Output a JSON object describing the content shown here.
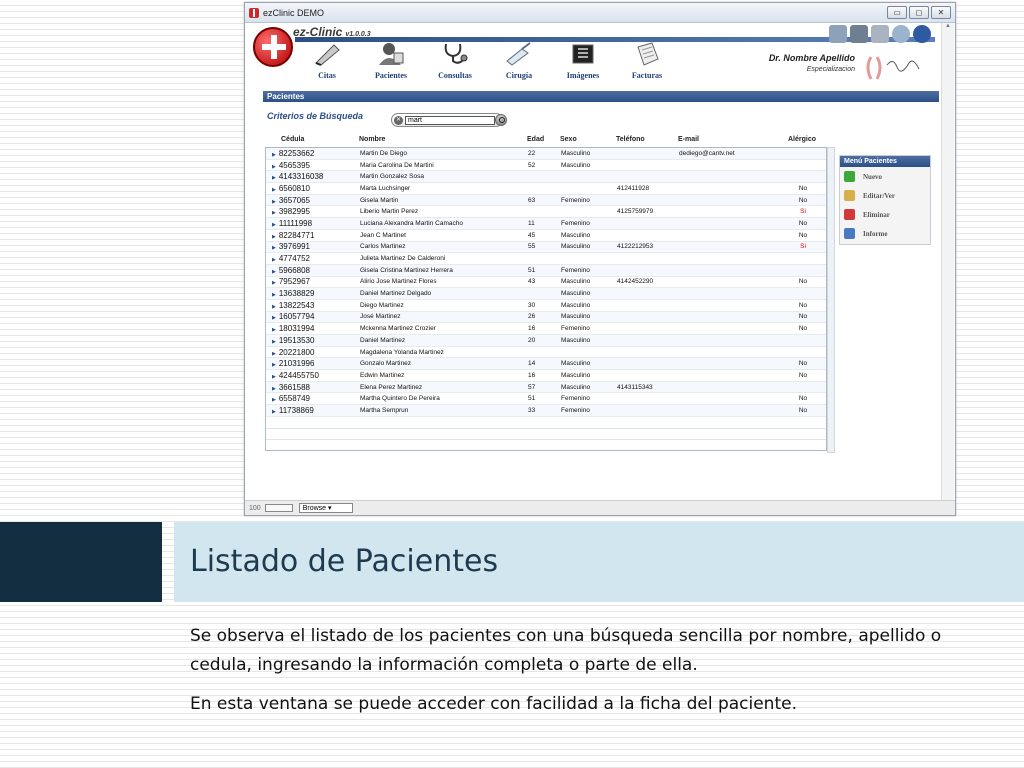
{
  "window": {
    "title": "ezClinic DEMO",
    "buttons": [
      "▭",
      "◻",
      "✕"
    ]
  },
  "app": {
    "name": "ez-Clinic",
    "version": "v1.0.0.3"
  },
  "nav": [
    {
      "label": "Citas",
      "icon": "pen-icon"
    },
    {
      "label": "Pacientes",
      "icon": "patient-icon"
    },
    {
      "label": "Consultas",
      "icon": "stethoscope-icon"
    },
    {
      "label": "Cirugía",
      "icon": "scalpel-icon"
    },
    {
      "label": "Imágenes",
      "icon": "xray-icon"
    },
    {
      "label": "Facturas",
      "icon": "invoice-icon"
    }
  ],
  "doctor": {
    "name": "Dr. Nombre Apellido",
    "specialty": "Especializacion"
  },
  "section": {
    "title": "Pacientes",
    "search_title": "Criterios de Búsqueda",
    "search_value": "mart"
  },
  "table": {
    "headers": {
      "cedula": "Cédula",
      "nombre": "Nombre",
      "edad": "Edad",
      "sexo": "Sexo",
      "telefono": "Teléfono",
      "email": "E-mail",
      "alergico": "Alérgico"
    },
    "rows": [
      {
        "cedula": "82253662",
        "nombre": "Martin De Diego",
        "edad": "22",
        "sexo": "Masculino",
        "telefono": "",
        "email": "dediego@cantv.net",
        "alergico": ""
      },
      {
        "cedula": "4565395",
        "nombre": "Maria Carolina De Martini",
        "edad": "52",
        "sexo": "Masculino",
        "telefono": "",
        "email": "",
        "alergico": ""
      },
      {
        "cedula": "4143316038",
        "nombre": "Martin Gonzalez Sosa",
        "edad": "",
        "sexo": "",
        "telefono": "",
        "email": "",
        "alergico": ""
      },
      {
        "cedula": "6560810",
        "nombre": "Marta Luchsinger",
        "edad": "",
        "sexo": "",
        "telefono": "412411928",
        "email": "",
        "alergico": "No"
      },
      {
        "cedula": "3657065",
        "nombre": "Gisela Martin",
        "edad": "63",
        "sexo": "Femenino",
        "telefono": "",
        "email": "",
        "alergico": "No"
      },
      {
        "cedula": "3982995",
        "nombre": "Liberio Martin Perez",
        "edad": "",
        "sexo": "",
        "telefono": "4125759979",
        "email": "",
        "alergico": "Si"
      },
      {
        "cedula": "11111998",
        "nombre": "Luciana Alexandra Martin Camacho",
        "edad": "11",
        "sexo": "Femenino",
        "telefono": "",
        "email": "",
        "alergico": "No"
      },
      {
        "cedula": "82284771",
        "nombre": "Jean C Martinet",
        "edad": "45",
        "sexo": "Masculino",
        "telefono": "",
        "email": "",
        "alergico": "No"
      },
      {
        "cedula": "3976991",
        "nombre": "Carlos Martinez",
        "edad": "55",
        "sexo": "Masculino",
        "telefono": "4122212953",
        "email": "",
        "alergico": "Si"
      },
      {
        "cedula": "4774752",
        "nombre": "Julieta Martinez De Calderoni",
        "edad": "",
        "sexo": "",
        "telefono": "",
        "email": "",
        "alergico": ""
      },
      {
        "cedula": "5966808",
        "nombre": "Gisela Cristina Martinez Herrera",
        "edad": "51",
        "sexo": "Femenino",
        "telefono": "",
        "email": "",
        "alergico": ""
      },
      {
        "cedula": "7952967",
        "nombre": "Alirio Jose Martinez Flores",
        "edad": "43",
        "sexo": "Masculino",
        "telefono": "4142452290",
        "email": "",
        "alergico": "No"
      },
      {
        "cedula": "13638829",
        "nombre": "Daniel Martinez Delgado",
        "edad": "",
        "sexo": "Masculino",
        "telefono": "",
        "email": "",
        "alergico": ""
      },
      {
        "cedula": "13822543",
        "nombre": "Diego Martinez",
        "edad": "30",
        "sexo": "Masculino",
        "telefono": "",
        "email": "",
        "alergico": "No"
      },
      {
        "cedula": "16057794",
        "nombre": "José Martinez",
        "edad": "26",
        "sexo": "Masculino",
        "telefono": "",
        "email": "",
        "alergico": "No"
      },
      {
        "cedula": "18031994",
        "nombre": "Mckenna Martinez Crozier",
        "edad": "16",
        "sexo": "Femenino",
        "telefono": "",
        "email": "",
        "alergico": "No"
      },
      {
        "cedula": "19513530",
        "nombre": "Daniel Martinez",
        "edad": "20",
        "sexo": "Masculino",
        "telefono": "",
        "email": "",
        "alergico": ""
      },
      {
        "cedula": "20221800",
        "nombre": "Magdalena Yolanda Martinez",
        "edad": "",
        "sexo": "",
        "telefono": "",
        "email": "",
        "alergico": ""
      },
      {
        "cedula": "21031996",
        "nombre": "Gonzalo Martinez",
        "edad": "14",
        "sexo": "Masculino",
        "telefono": "",
        "email": "",
        "alergico": "No"
      },
      {
        "cedula": "424455750",
        "nombre": "Edwin Martinez",
        "edad": "16",
        "sexo": "Masculino",
        "telefono": "",
        "email": "",
        "alergico": "No"
      },
      {
        "cedula": "3661588",
        "nombre": "Elena Perez Martinez",
        "edad": "57",
        "sexo": "Masculino",
        "telefono": "4143115343",
        "email": "",
        "alergico": ""
      },
      {
        "cedula": "6558749",
        "nombre": "Martha Quintero De Pereira",
        "edad": "51",
        "sexo": "Femenino",
        "telefono": "",
        "email": "",
        "alergico": "No"
      },
      {
        "cedula": "11738869",
        "nombre": "Martha Semprun",
        "edad": "33",
        "sexo": "Femenino",
        "telefono": "",
        "email": "",
        "alergico": "No"
      }
    ]
  },
  "menu": {
    "title": "Menú Pacientes",
    "items": [
      {
        "label": "Nuevo",
        "icon": "add-icon",
        "color": "#3aa83a"
      },
      {
        "label": "Editar/Ver",
        "icon": "edit-icon",
        "color": "#d8b04a"
      },
      {
        "label": "Eliminar",
        "icon": "delete-icon",
        "color": "#d23a3a"
      },
      {
        "label": "Informe",
        "icon": "report-icon",
        "color": "#4a79c4"
      }
    ]
  },
  "statusbar": {
    "zoom": "100",
    "view_option": "Browse"
  },
  "slide": {
    "title": "Listado de Pacientes",
    "paragraph1": "Se observa el listado de los pacientes con una búsqueda sencilla por nombre, apellido o cedula, ingresando la información completa o parte de ella.",
    "paragraph2": "En esta ventana se puede acceder con facilidad a la ficha del paciente."
  },
  "colors": {
    "header_blue": "#2b4f86",
    "title_band": "#d2e6f0",
    "dark_block": "#132e41",
    "allergy_yes": "#e00000"
  }
}
